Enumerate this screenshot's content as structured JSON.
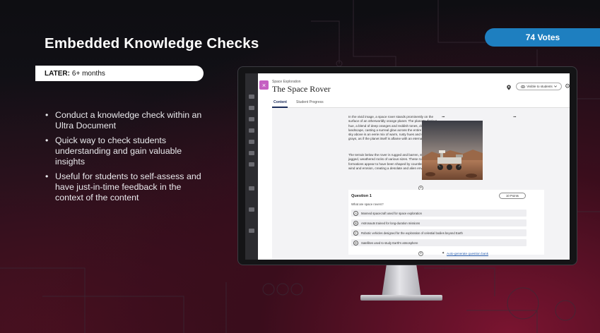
{
  "slide": {
    "title": "Embedded Knowledge Checks",
    "votes": "74 Votes",
    "timeframe_label": "LATER:",
    "timeframe_value": "6+ months",
    "bullets": [
      "Conduct a knowledge check within an Ultra Document",
      "Quick way to check students understanding and gain valuable insights",
      "Useful for students to self-assess and have just-in-time feedback in the context of the content"
    ]
  },
  "colors": {
    "votes_badge": "#1e7fc0",
    "accent_magenta": "#c560c2",
    "link": "#2a5fb0"
  },
  "document": {
    "close_glyph": "×",
    "breadcrumb": "Space Exploration",
    "title": "The Space Rover",
    "visibility": "Visible to students",
    "tabs": [
      "Content",
      "Student Progress"
    ],
    "paragraph1": "In the vivid image, a space rover stands prominently on the surface of an otherworldly orange planet. The planet's distinct hue, a blend of deep oranges and reddish tones, dominates the landscape, casting a surreal glow across the entire scene. The sky above is an eerie mix of warm, rusty hues and smoky grays, as if the planet itself is aflame with an eternal sunset.",
    "paragraph2": "The terrain below the rover is rugged and barren, strewn with jagged, weathered rocks of various sizes. These rocky formations appear to have been shaped by countless years of wind and erosion, creating a desolate and alien environment.",
    "more_glyph": "···",
    "plus_glyph": "+",
    "question": {
      "title": "Question 1",
      "points": "10 Points",
      "prompt": "What are space rovers?",
      "options": [
        {
          "letter": "A",
          "text": "Manned spacecraft used for space exploration"
        },
        {
          "letter": "B",
          "text": "Astronauts trained for long-duration missions"
        },
        {
          "letter": "C",
          "text": "Robotic vehicles designed for the exploration of celestial bodies beyond Earth"
        },
        {
          "letter": "D",
          "text": "Satellites used to study Earth's atmosphere"
        }
      ]
    },
    "auto_generate": "Auto-generate question bank"
  }
}
